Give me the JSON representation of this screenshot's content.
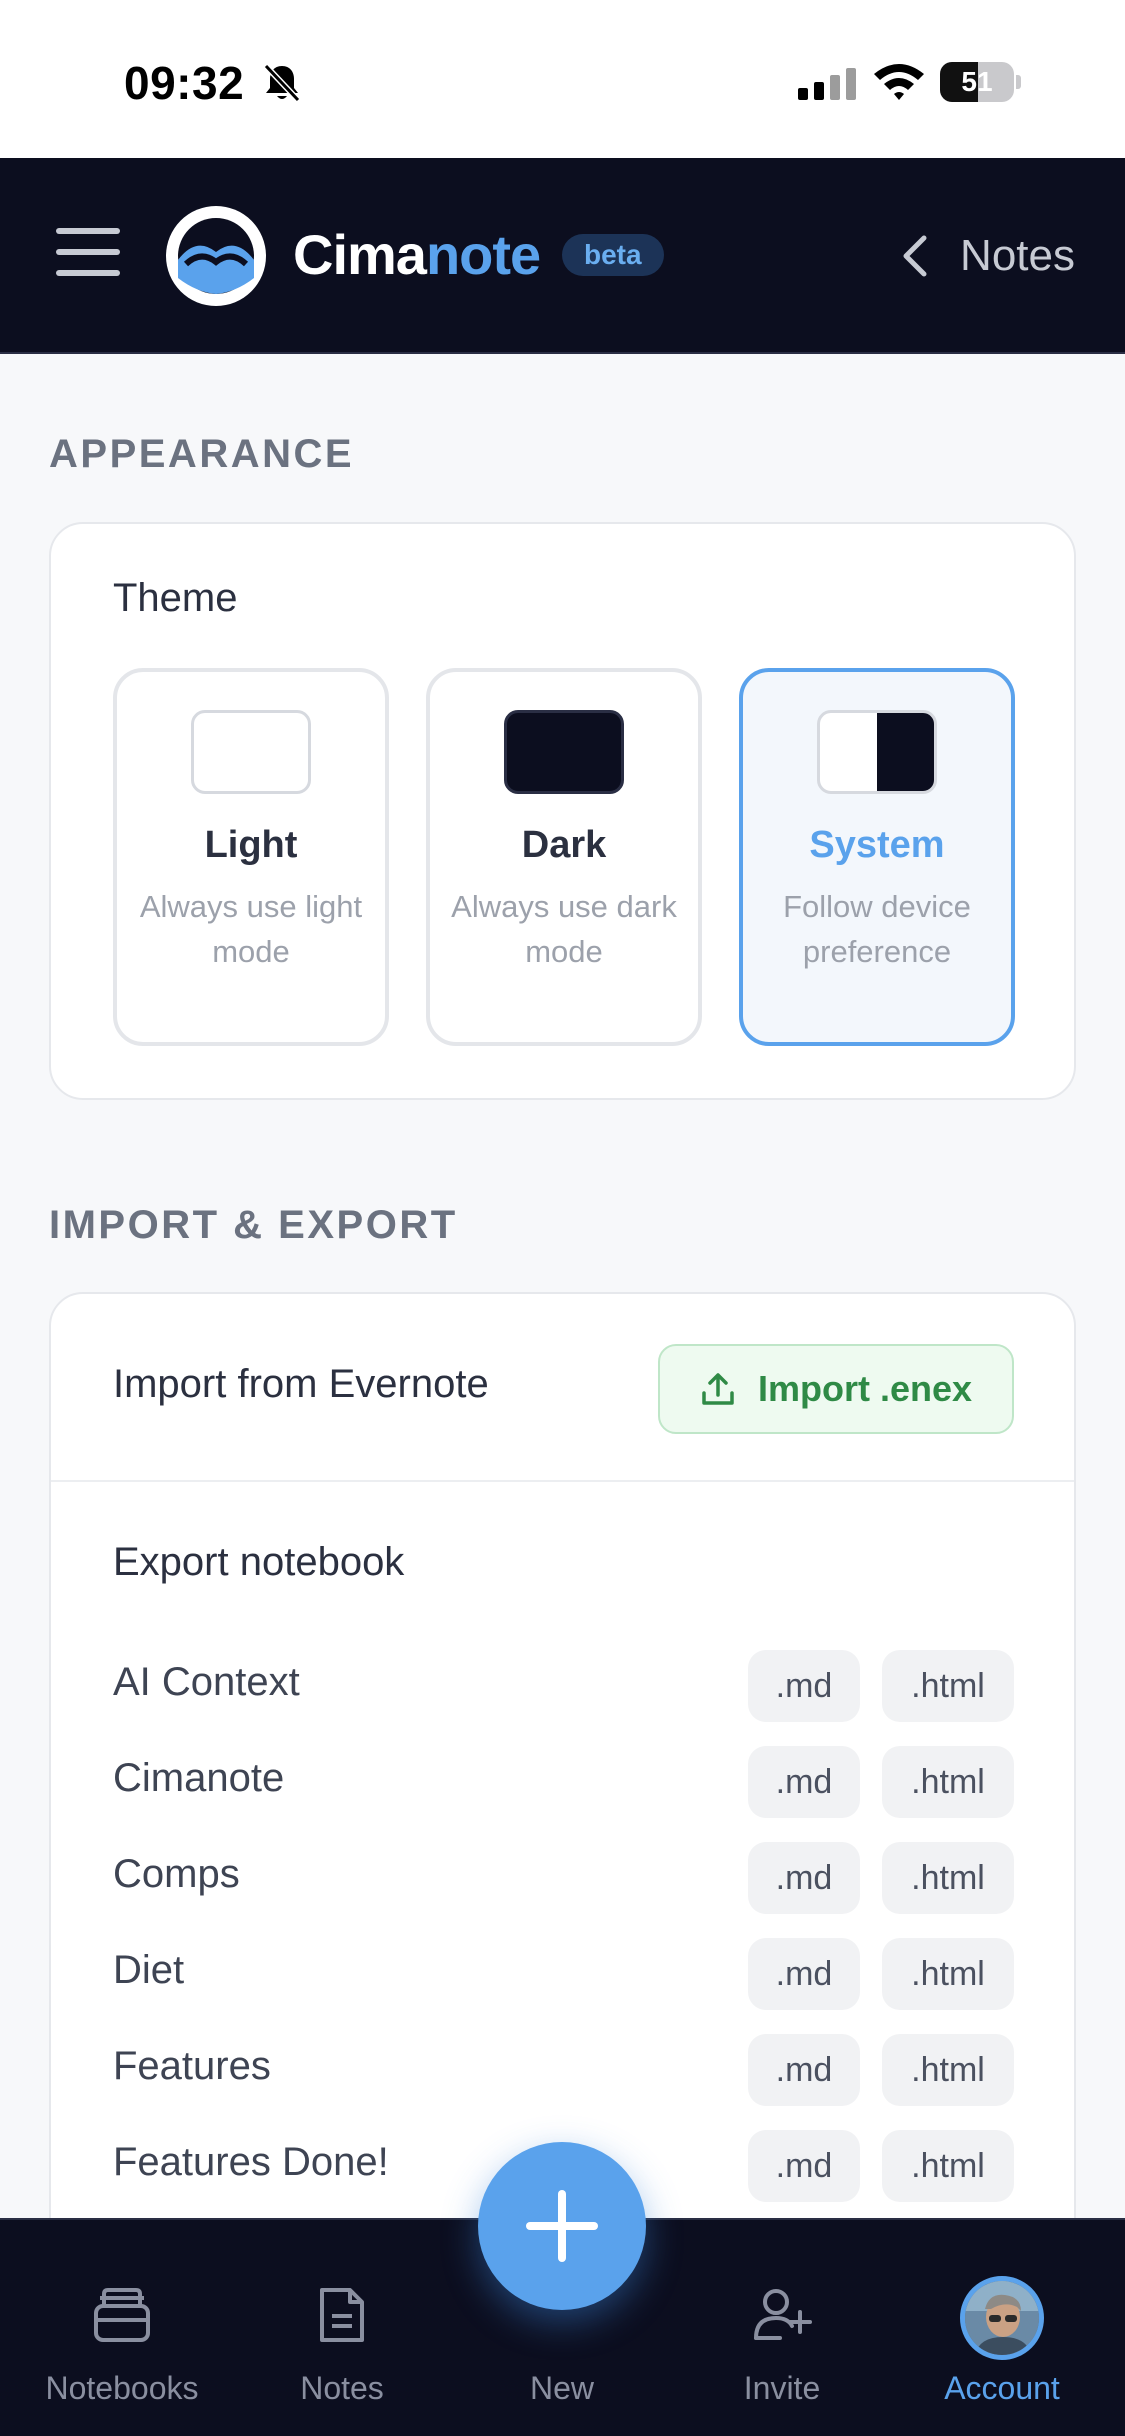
{
  "status_bar": {
    "time": "09:32",
    "battery": "51",
    "battery_level": 0.51
  },
  "header": {
    "brand_first": "Cima",
    "brand_second": "note",
    "badge": "beta",
    "back_label": "Notes"
  },
  "appearance": {
    "section_title": "APPEARANCE",
    "theme_label": "Theme",
    "options": [
      {
        "name": "Light",
        "desc": "Always use light mode",
        "selected": false
      },
      {
        "name": "Dark",
        "desc": "Always use dark mode",
        "selected": false
      },
      {
        "name": "System",
        "desc": "Follow device preference",
        "selected": true
      }
    ]
  },
  "import_export": {
    "section_title": "IMPORT & EXPORT",
    "import_label": "Import from Evernote",
    "import_button": "Import .enex",
    "export_title": "Export notebook",
    "md_label": ".md",
    "html_label": ".html",
    "notebooks": [
      "AI Context",
      "Cimanote",
      "Comps",
      "Diet",
      "Features",
      "Features Done!"
    ]
  },
  "tabs": [
    {
      "label": "Notebooks",
      "icon": "notebooks-icon",
      "active": false
    },
    {
      "label": "Notes",
      "icon": "note-icon",
      "active": false
    },
    {
      "label": "New",
      "icon": "plus-icon",
      "active": false
    },
    {
      "label": "Invite",
      "icon": "invite-user-icon",
      "active": false
    },
    {
      "label": "Account",
      "icon": "avatar",
      "active": true
    }
  ],
  "colors": {
    "accent": "#5aa2ec",
    "header_bg": "#0c0e1f",
    "import_green": "#2f8a46"
  }
}
